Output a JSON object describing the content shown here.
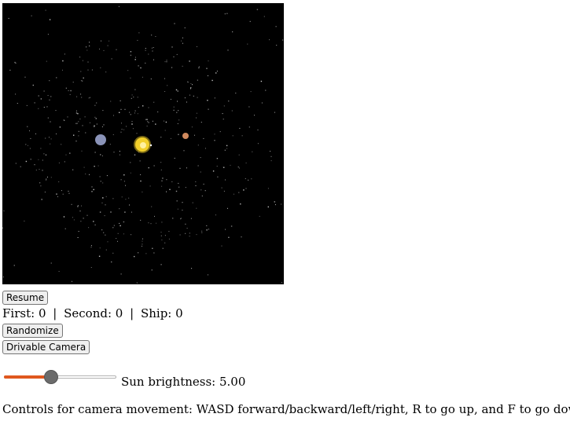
{
  "buttons": {
    "resume": "Resume",
    "randomize": "Randomize",
    "drivable_camera": "Drivable Camera"
  },
  "scores": [
    {
      "label": "First:",
      "value": "0"
    },
    {
      "label": "Second:",
      "value": "0"
    },
    {
      "label": "Ship:",
      "value": "0"
    }
  ],
  "separator": "|",
  "brightness": {
    "label": "Sun brightness: 5.00",
    "value": 5.0,
    "fill_fraction": 0.42
  },
  "controls_text": "Controls for camera movement: WASD forward/backward/left/right, R to go up, and F to go down",
  "colors": {
    "space": "#000000",
    "sun": "#f2cf2a",
    "sun_core": "#fff0a0",
    "planet_left": "#8a93b8",
    "planet_right": "#d08a5e",
    "slider_fill": "#e0581f",
    "slider_thumb": "#6b6b6b"
  }
}
